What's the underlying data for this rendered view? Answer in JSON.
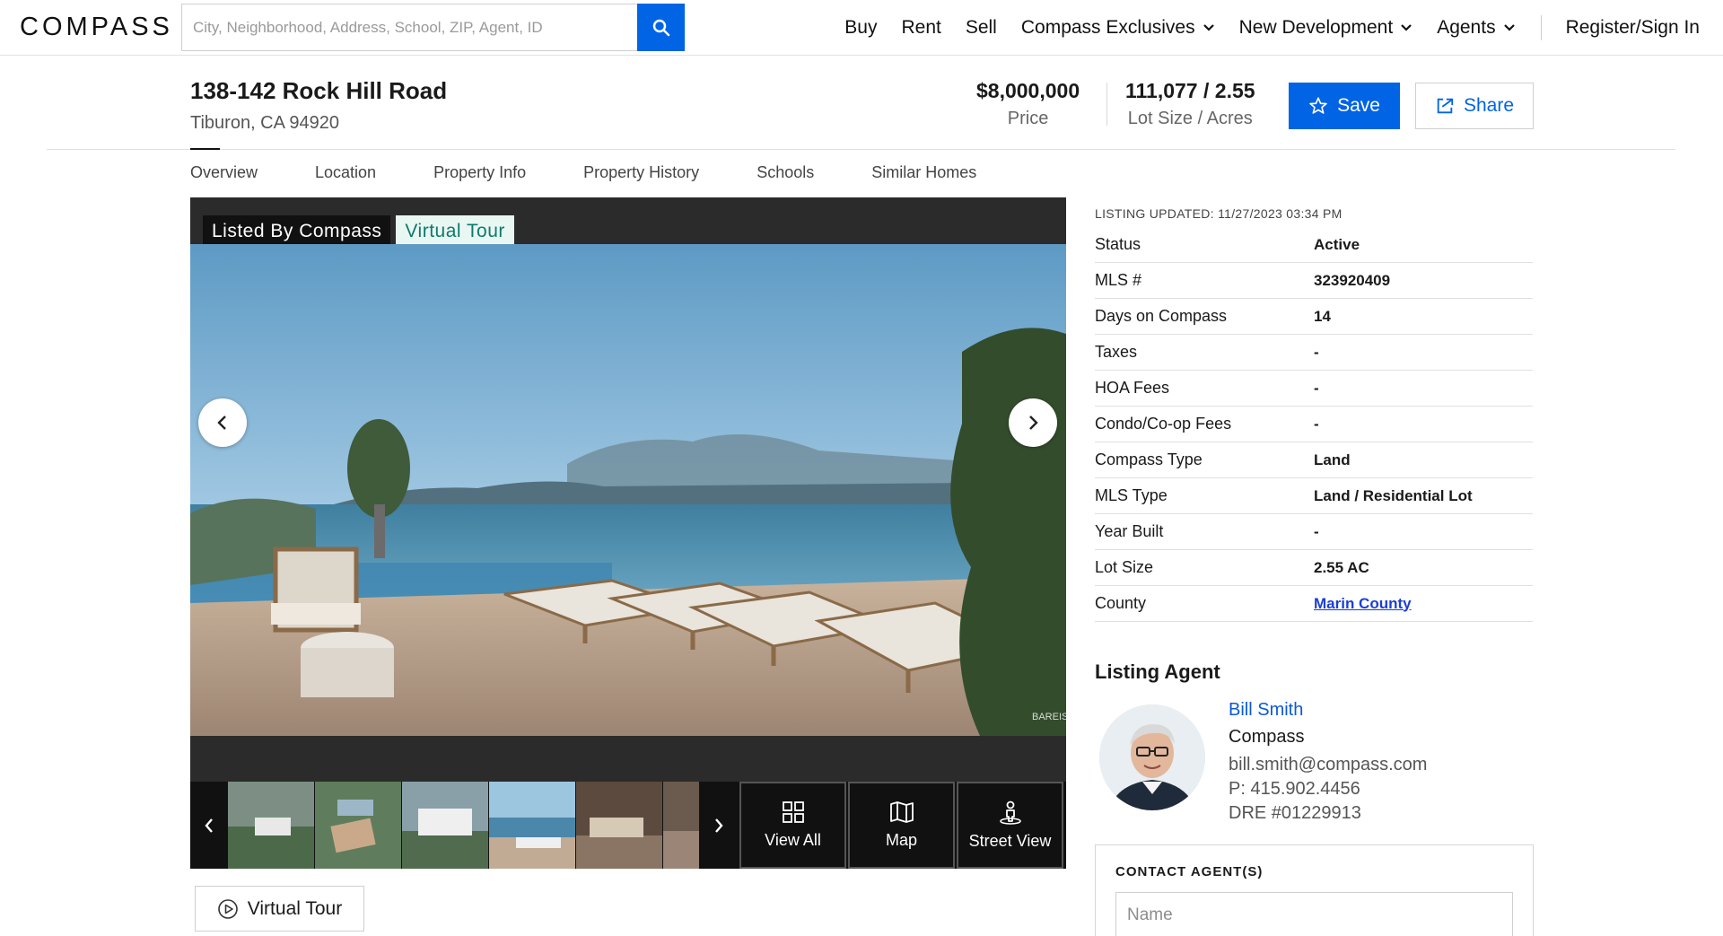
{
  "header": {
    "logo": "COMPASS",
    "search_placeholder": "City, Neighborhood, Address, School, ZIP, Agent, ID",
    "nav": {
      "buy": "Buy",
      "rent": "Rent",
      "sell": "Sell",
      "exclusives": "Compass Exclusives",
      "new_dev": "New Development",
      "agents": "Agents",
      "signin": "Register/Sign In"
    }
  },
  "property": {
    "address": "138-142 Rock Hill Road",
    "city": "Tiburon, CA 94920",
    "price": "$8,000,000",
    "price_label": "Price",
    "lot": "111,077 / 2.55",
    "lot_label": "Lot Size / Acres",
    "save_label": "Save",
    "share_label": "Share"
  },
  "tabs": [
    "Overview",
    "Location",
    "Property Info",
    "Property History",
    "Schools",
    "Similar Homes"
  ],
  "gallery": {
    "tag_listed": "Listed By Compass",
    "tag_tour": "Virtual Tour",
    "watermark": "BAREIS MLS",
    "view_all": "View All",
    "map": "Map",
    "street_view": "Street View",
    "virtual_tour_button": "Virtual Tour"
  },
  "details": {
    "updated": "LISTING UPDATED: 11/27/2023 03:34 PM",
    "rows": [
      {
        "k": "Status",
        "v": "Active"
      },
      {
        "k": "MLS #",
        "v": "323920409"
      },
      {
        "k": "Days on Compass",
        "v": "14"
      },
      {
        "k": "Taxes",
        "v": "-"
      },
      {
        "k": "HOA Fees",
        "v": "-"
      },
      {
        "k": "Condo/Co-op Fees",
        "v": "-"
      },
      {
        "k": "Compass Type",
        "v": "Land"
      },
      {
        "k": "MLS Type",
        "v": "Land / Residential Lot"
      },
      {
        "k": "Year Built",
        "v": "-"
      },
      {
        "k": "Lot Size",
        "v": "2.55 AC"
      },
      {
        "k": "County",
        "v": "Marin County"
      }
    ]
  },
  "agent": {
    "heading": "Listing Agent",
    "name": "Bill Smith",
    "company": "Compass",
    "email": "bill.smith@compass.com",
    "phone": "P: 415.902.4456",
    "dre": "DRE #01229913"
  },
  "contact": {
    "heading": "CONTACT AGENT(S)",
    "name_placeholder": "Name"
  },
  "colors": {
    "brand_blue": "#0064e5",
    "link_blue": "#1a3fd6",
    "tour_teal": "#0e7a6a"
  }
}
